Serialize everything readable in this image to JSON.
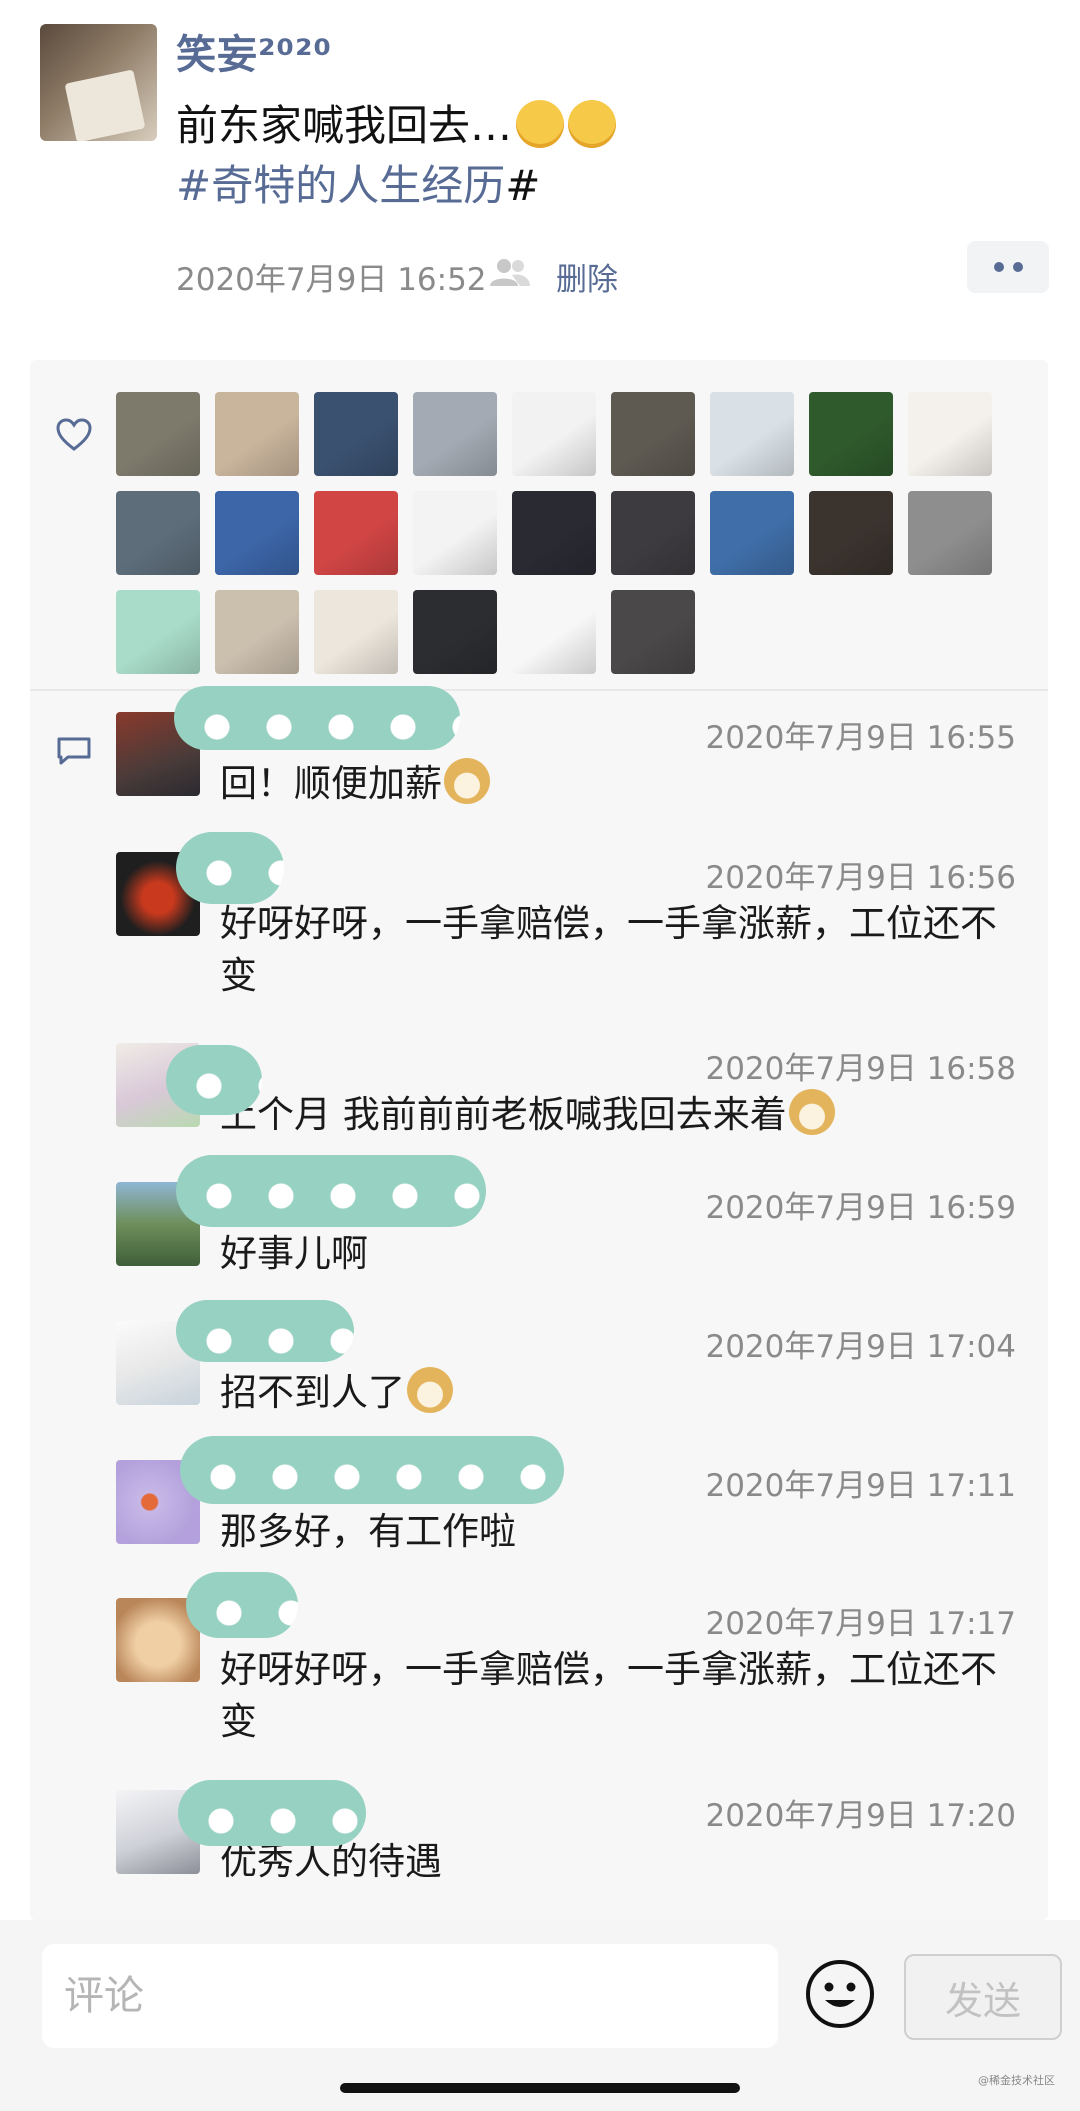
{
  "post": {
    "author": "笑妄²⁰²⁰",
    "text": "前东家喊我回去…",
    "emoji_names": [
      "laughing-tears-icon",
      "laughing-tears-icon"
    ],
    "hashtag": "#奇特的人生经历",
    "hashtag_suffix": "#",
    "time": "2020年7月9日 16:52",
    "delete_label": "删除",
    "more_icon": "more-dots-icon"
  },
  "likes": {
    "icon": "heart-icon",
    "avatar_colors": [
      "#7d7a6c",
      "#c9b49c",
      "#3a5170",
      "#a3aab3",
      "#f2f2f2",
      "#5e5a52",
      "#d9e1e6",
      "#2f5a2c",
      "#f4f0ec",
      "#5d6d7a",
      "#3c66a8",
      "#d14545",
      "#f3f3f3",
      "#2a2a33",
      "#3d3b3f",
      "#3f6ea8",
      "#3a332e",
      "#8e8e8e",
      "#a9dcc9",
      "#cbbfae",
      "#ece6dc",
      "#2b2d30",
      "#f7f7f7",
      "#4a4848"
    ]
  },
  "comments_icon": "comment-icon",
  "comments": [
    {
      "time": "2020年7月9日 16:55",
      "text": "回！顺便加薪",
      "avatar_color": "#6a4a3e",
      "emoji": true
    },
    {
      "time": "2020年7月9日 16:56",
      "text": "好呀好呀，一手拿赔偿，一手拿涨薪，工位还不变",
      "avatar_color": "#1f1f1f",
      "emoji": false
    },
    {
      "time": "2020年7月9日 16:58",
      "text": "上个月 我前前前老板喊我回去来着",
      "avatar_color": "#e6dfd6",
      "emoji": true
    },
    {
      "time": "2020年7月9日 16:59",
      "text": "好事儿啊",
      "avatar_color": "#4f7d5a",
      "emoji": false
    },
    {
      "time": "2020年7月9日 17:04",
      "text": "招不到人了",
      "avatar_color": "#f2f4f6",
      "emoji": true
    },
    {
      "time": "2020年7月9日 17:11",
      "text": "那多好，有工作啦",
      "avatar_color": "#b5a3dc",
      "emoji": false
    },
    {
      "time": "2020年7月9日 17:17",
      "text": "好呀好呀，一手拿赔偿，一手拿涨薪，工位还不变",
      "avatar_color": "#d6a878",
      "emoji": false
    },
    {
      "time": "2020年7月9日 17:20",
      "text": "优秀人的待遇",
      "avatar_color": "#cfd1d8",
      "emoji": false
    }
  ],
  "input": {
    "placeholder": "评论",
    "value": "",
    "emoji_icon": "smile-icon",
    "send_label": "发送"
  },
  "watermark": "@稀金技术社区"
}
